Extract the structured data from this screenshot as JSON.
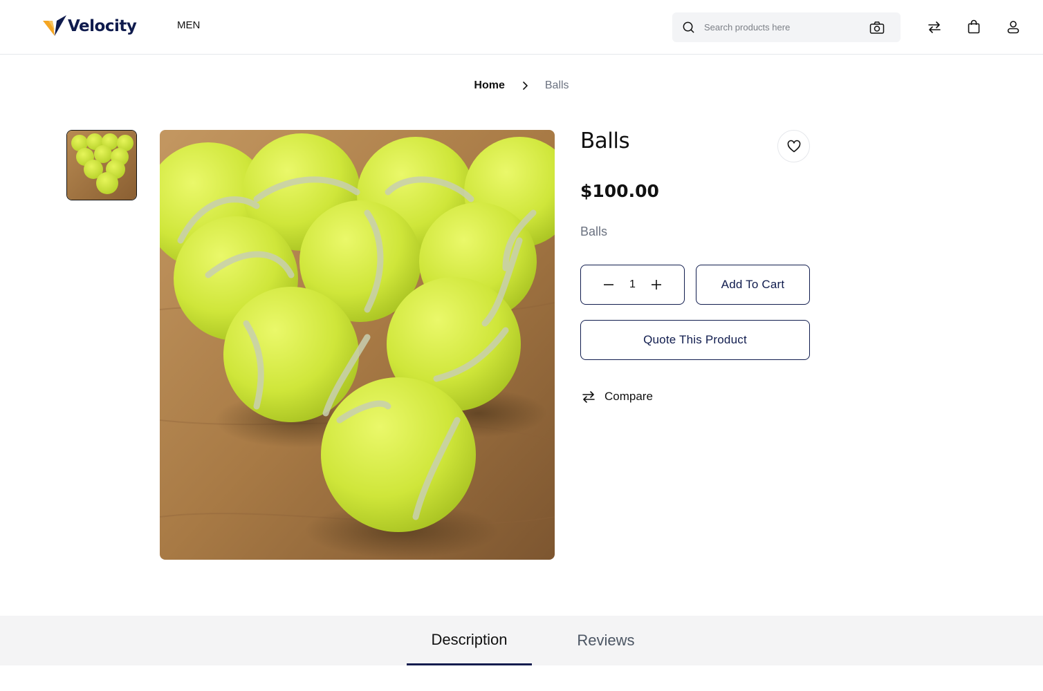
{
  "header": {
    "brand": "Velocity",
    "nav": {
      "men": "MEN"
    },
    "search": {
      "placeholder": "Search products here",
      "value": ""
    },
    "icons": [
      "search-icon",
      "camera-icon",
      "compare-icon",
      "cart-icon",
      "user-icon"
    ]
  },
  "breadcrumb": {
    "home": "Home",
    "current": "Balls"
  },
  "product": {
    "title": "Balls",
    "price": "$100.00",
    "short_description": "Balls",
    "quantity": "1",
    "add_to_cart_label": "Add To Cart",
    "quote_label": "Quote This Product",
    "compare_label": "Compare"
  },
  "tabs": [
    {
      "label": "Description",
      "active": true
    },
    {
      "label": "Reviews",
      "active": false
    }
  ],
  "colors": {
    "brand_navy": "#0f1b4d",
    "logo_orange": "#f5a623",
    "tab_bar_bg": "#f4f4f5",
    "ball_green": "#d4ec3a",
    "wood": "#a87a45"
  }
}
